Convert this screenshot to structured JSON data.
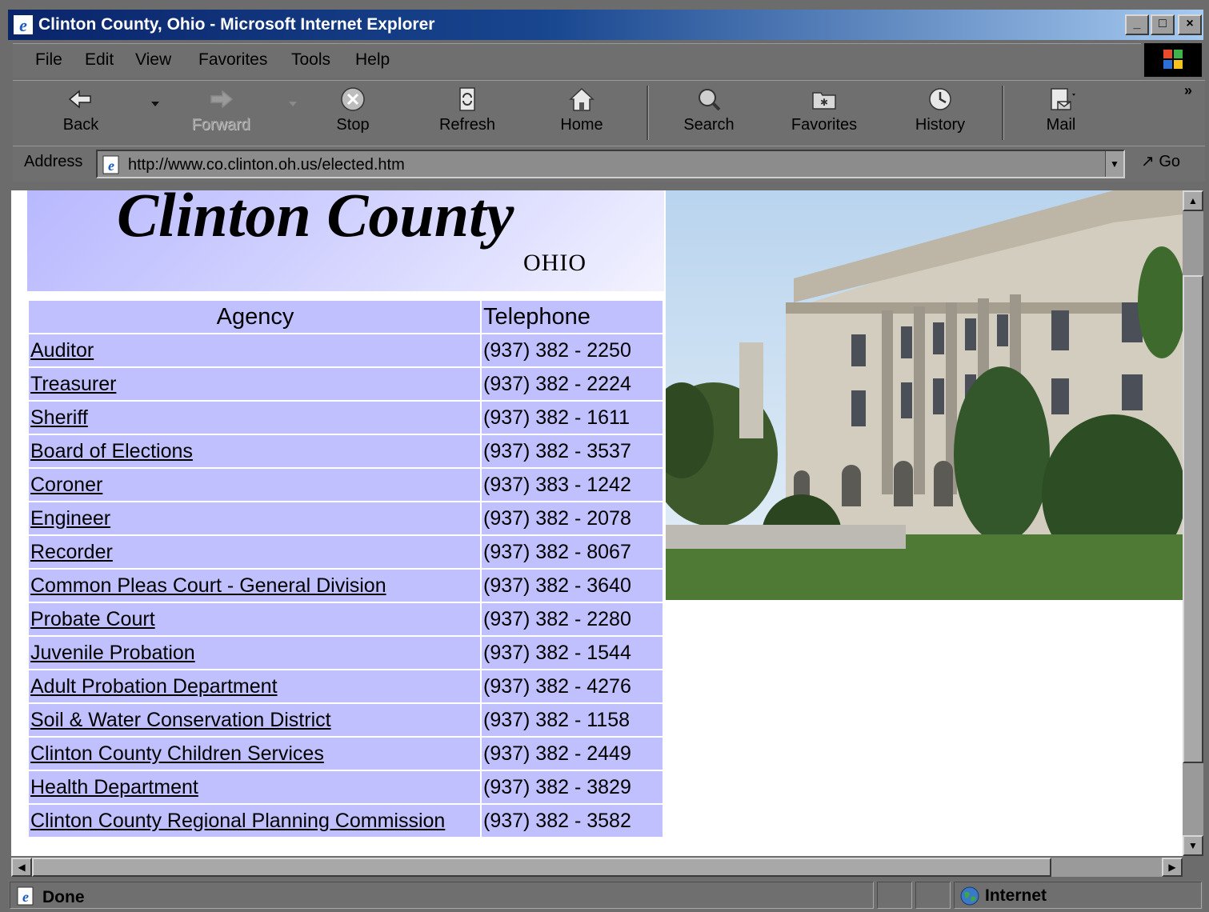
{
  "window": {
    "title": "Clinton County, Ohio - Microsoft Internet Explorer",
    "controls": {
      "minimize": "_",
      "maximize": "□",
      "close": "×"
    }
  },
  "menu": {
    "items": [
      {
        "label": "File"
      },
      {
        "label": "Edit"
      },
      {
        "label": "View"
      },
      {
        "label": "Favorites"
      },
      {
        "label": "Tools"
      },
      {
        "label": "Help"
      }
    ]
  },
  "toolbar": {
    "back": "Back",
    "forward": "Forward",
    "stop": "Stop",
    "refresh": "Refresh",
    "home": "Home",
    "search": "Search",
    "favorites": "Favorites",
    "history": "History",
    "mail": "Mail",
    "overflow": "»"
  },
  "address": {
    "label": "Address",
    "url": "http://www.co.clinton.oh.us/elected.htm",
    "go": "Go"
  },
  "page": {
    "banner_title": "Clinton County",
    "banner_subtitle": "OHIO",
    "table": {
      "headers": {
        "agency": "Agency",
        "telephone": "Telephone"
      },
      "rows": [
        {
          "agency": "Auditor",
          "phone": "(937) 382 - 2250"
        },
        {
          "agency": "Treasurer",
          "phone": "(937) 382 - 2224"
        },
        {
          "agency": "Sheriff",
          "phone": "(937) 382 - 1611"
        },
        {
          "agency": "Board of Elections",
          "phone": "(937) 382 - 3537"
        },
        {
          "agency": "Coroner",
          "phone": "(937) 383 - 1242"
        },
        {
          "agency": "Engineer",
          "phone": "(937) 382 - 2078"
        },
        {
          "agency": "Recorder",
          "phone": "(937) 382 - 8067"
        },
        {
          "agency": "Common Pleas Court - General Division",
          "phone": "(937) 382 - 3640"
        },
        {
          "agency": "Probate Court",
          "phone": "(937) 382 - 2280"
        },
        {
          "agency": "Juvenile Probation",
          "phone": "(937) 382 - 1544"
        },
        {
          "agency": "Adult Probation Department",
          "phone": "(937) 382 - 4276"
        },
        {
          "agency": "Soil & Water Conservation District",
          "phone": "(937) 382 - 1158"
        },
        {
          "agency": "Clinton County Children Services",
          "phone": "(937) 382 - 2449"
        },
        {
          "agency": "Health Department",
          "phone": "(937) 382 - 3829"
        },
        {
          "agency": "Clinton County Regional Planning Commission",
          "phone": "(937) 382 - 3582"
        }
      ]
    }
  },
  "status": {
    "text": "Done",
    "zone": "Internet"
  },
  "colors": {
    "table_bg": "#c0c0ff",
    "titlebar": "#0a246a",
    "chrome": "#6f6f6f"
  }
}
